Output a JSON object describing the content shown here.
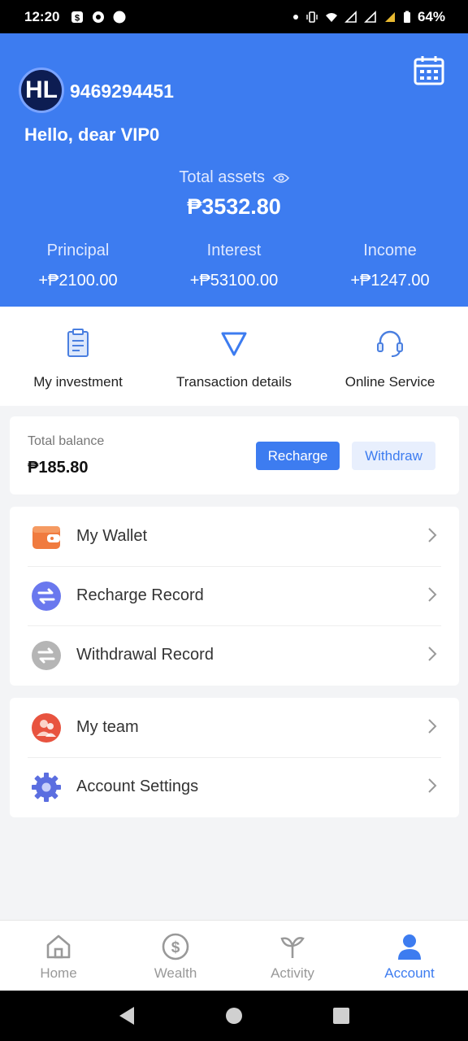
{
  "status_bar": {
    "time": "12:20",
    "battery": "64%"
  },
  "header": {
    "avatar_initials": "HL",
    "phone": "9469294451",
    "greeting": "Hello, dear VIP0",
    "total_assets_label": "Total assets",
    "total_assets_value": "₱3532.80",
    "stats": [
      {
        "label": "Principal",
        "value": "+₱2100.00"
      },
      {
        "label": "Interest",
        "value": "+₱53100.00"
      },
      {
        "label": "Income",
        "value": "+₱1247.00"
      }
    ]
  },
  "quick_actions": [
    {
      "label": "My investment",
      "icon": "clipboard-icon"
    },
    {
      "label": "Transaction details",
      "icon": "triangle-icon"
    },
    {
      "label": "Online Service",
      "icon": "headset-icon"
    }
  ],
  "balance": {
    "label": "Total balance",
    "value": "₱185.80",
    "recharge_label": "Recharge",
    "withdraw_label": "Withdraw"
  },
  "menu_group_1": [
    {
      "label": "My Wallet",
      "icon": "wallet-icon"
    },
    {
      "label": "Recharge Record",
      "icon": "recharge-exchange-icon"
    },
    {
      "label": "Withdrawal Record",
      "icon": "withdraw-exchange-icon"
    }
  ],
  "menu_group_2": [
    {
      "label": "My team",
      "icon": "team-icon"
    },
    {
      "label": "Account Settings",
      "icon": "gear-icon"
    }
  ],
  "bottom_nav": [
    {
      "label": "Home",
      "icon": "home-icon"
    },
    {
      "label": "Wealth",
      "icon": "coin-icon"
    },
    {
      "label": "Activity",
      "icon": "sprout-icon"
    },
    {
      "label": "Account",
      "icon": "user-icon",
      "active": true
    }
  ],
  "colors": {
    "primary": "#3d7cf0",
    "header_bg": "#3d7cf0",
    "wallet_orange": "#f07b3f"
  }
}
